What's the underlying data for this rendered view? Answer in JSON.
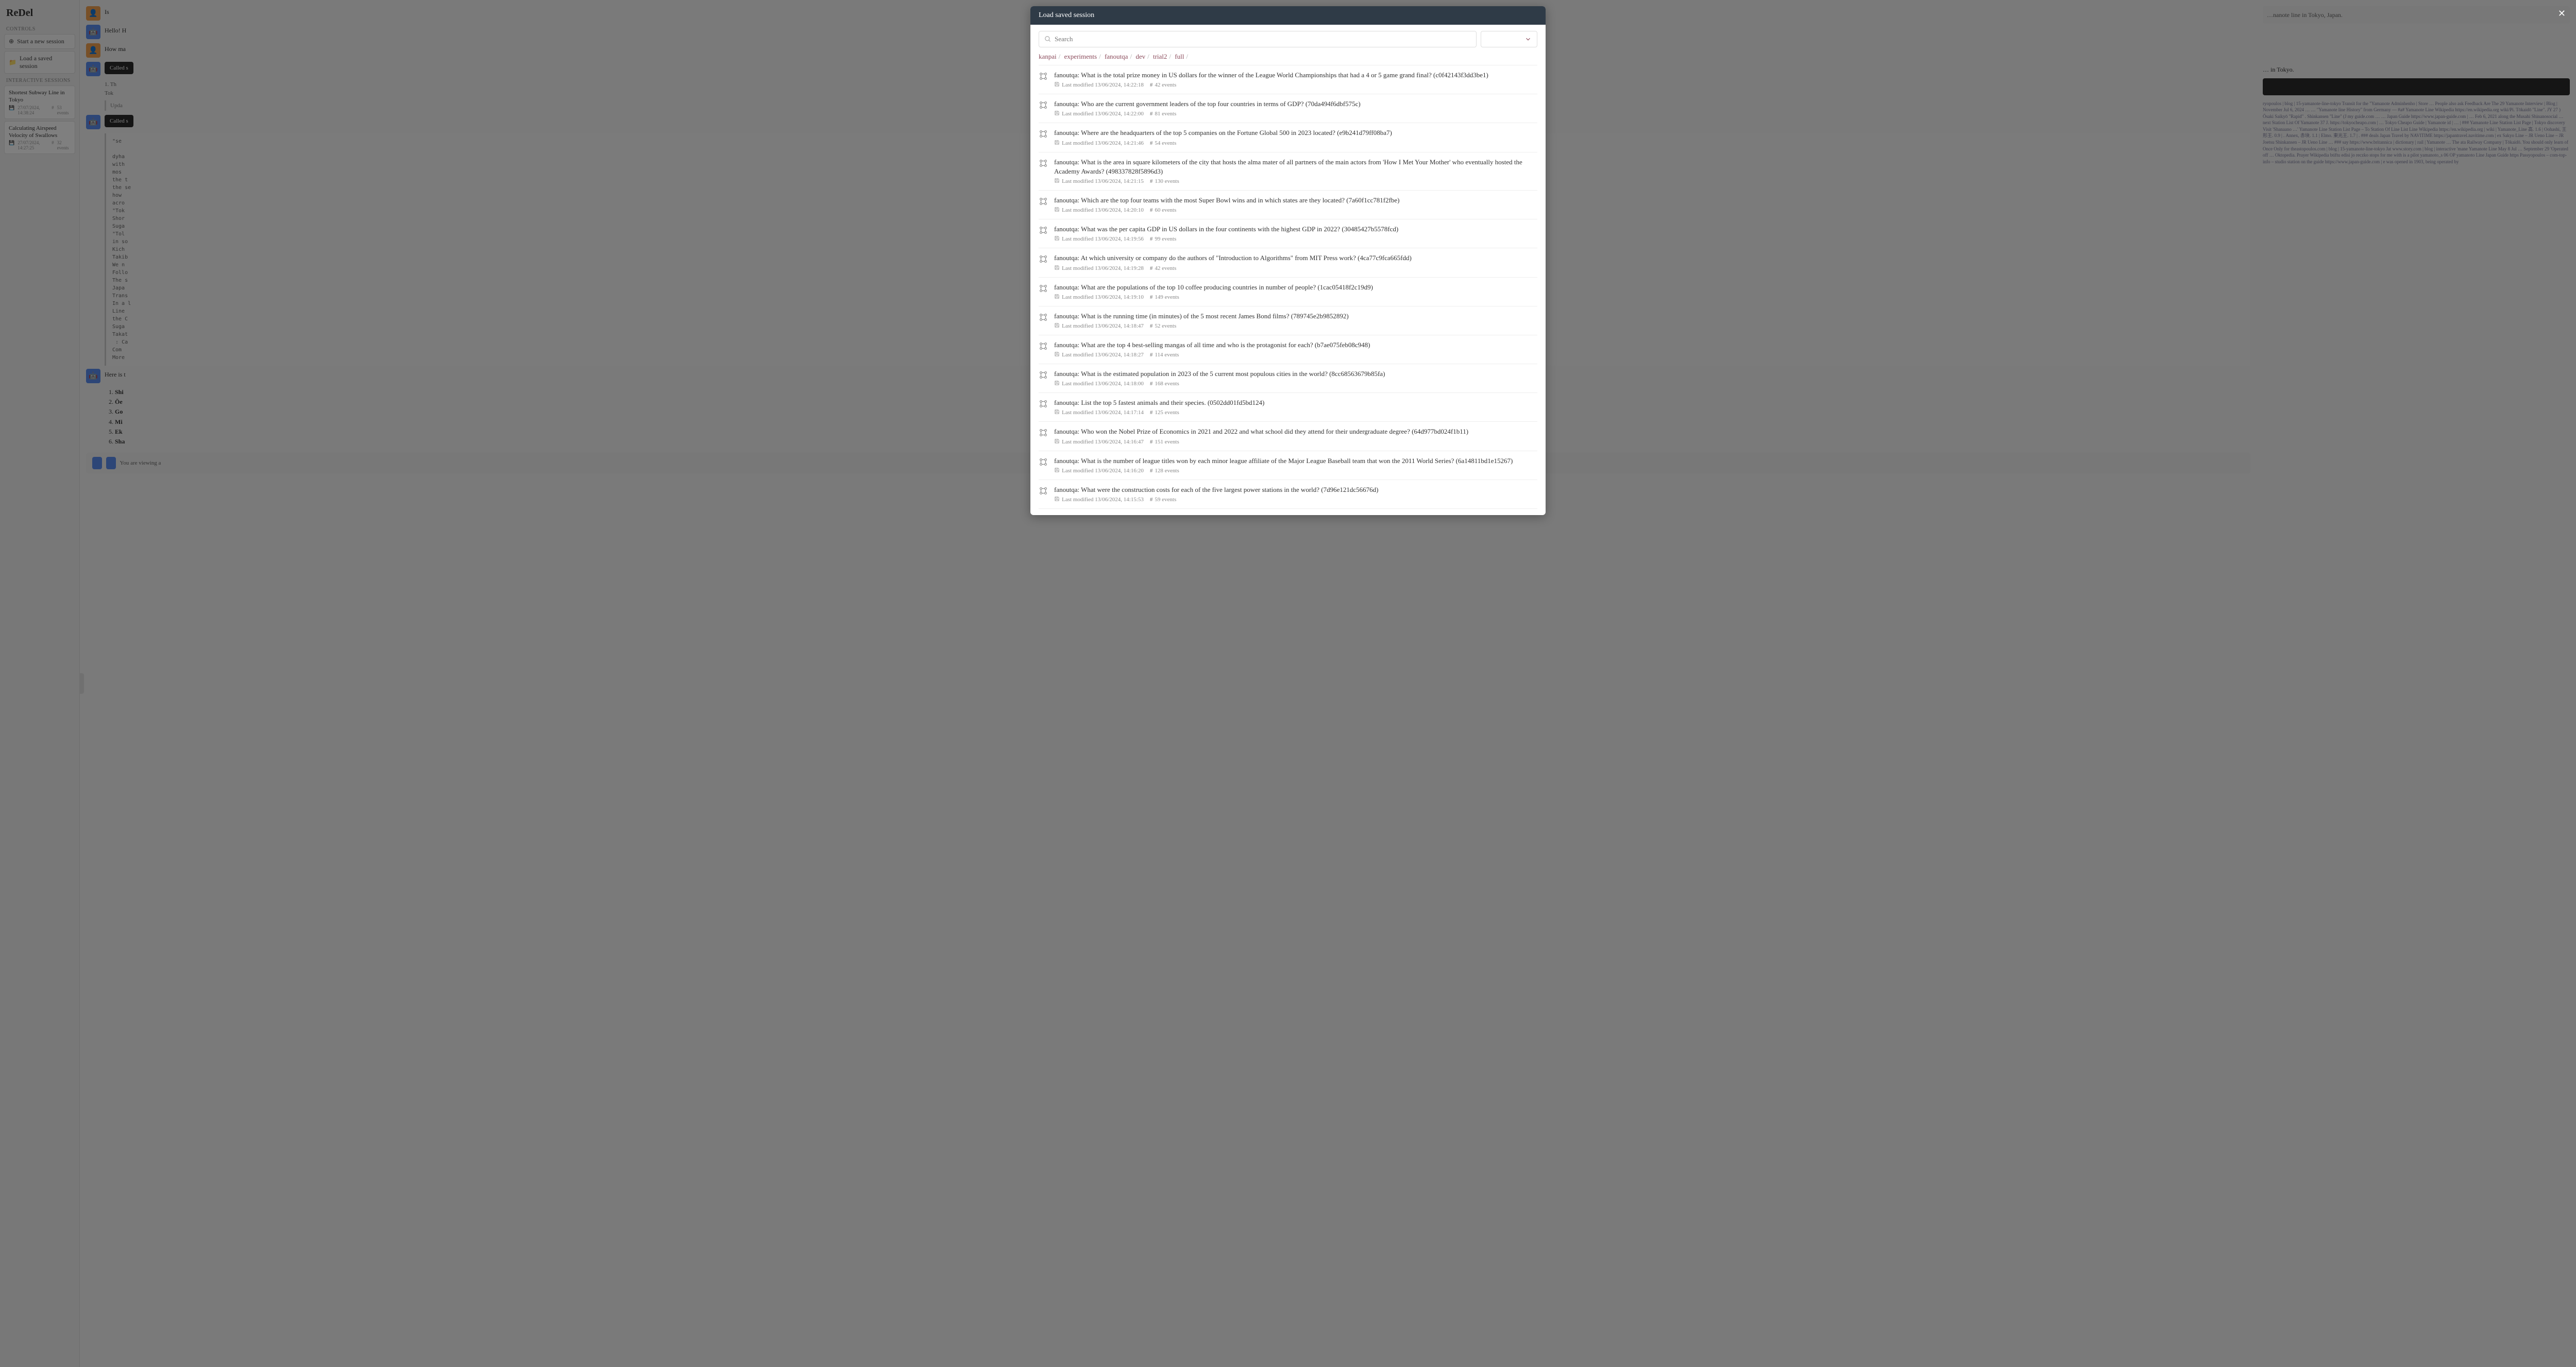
{
  "app": {
    "name": "ReDel"
  },
  "sidebar": {
    "controls_label": "CONTROLS",
    "start_new": "Start a new session",
    "load_saved": "Load a saved session",
    "interactive_label": "INTERACTIVE SESSIONS",
    "sessions": [
      {
        "title": "Shortest Subway Line in Tokyo",
        "date": "27/07/2024, 14:38:24",
        "events": "53 events"
      },
      {
        "title": "Calculating Airspeed Velocity of Swallows",
        "date": "27/07/2024, 14:27:25",
        "events": "32 events"
      }
    ]
  },
  "chat": {
    "msg_user_1": "Is",
    "msg_bot_1": "Hello! H",
    "msg_user_2": "How ma",
    "called_1": "Called s",
    "step_1": "1. Th",
    "step_2": "Tok",
    "updated": "Upda",
    "called_2": "Called s",
    "code_snippet": "\"se\n\ndyha\nwith\nmos\nthe t\nthe se\nhow\nacro\n\"Tok\nShor\nSuga\n\"Tol\nin so\nKich\nTakib\nWe n\nFollo\nThe s\nJapa\nTrans\nIn a l\nLine\nthe C\nSuga\nTakat\n : Ca\nCom\nMore",
    "msg_bot_2": "Here is t",
    "list_items": [
      "Shi",
      "Ōe",
      "Go",
      "Mi",
      "Ek",
      "Sha"
    ],
    "notice": "You are viewing a",
    "right_title": "…nanote line in Tokyo, Japan.",
    "right_sub": "… in Tokyo.",
    "right_blurb": "ryopoulos | blog | 15-yamanote-line-tokyo Transit for the \"Yamanote Adminhenho | Store … People also ask Feedback Are The 29 Yamanote Interview | Blog | November Jul 6, 2024 … … \"Yamanote line History\" from Germany — #a# Yamanote Line Wikipedia https://en.wikipedia.org wiki/Pi. Tōkaidō \"Line\". JY 27 ) Ōsaki Saikyō \"Rapid\" . Shinkansen \"Line\" (J my guide.com … … Japan Guide https://www.japan-guide.com | … Feb 6, 2021 along the Musahi Shinanosocial … next Station List Of Yamanote 37 J. https://tokyocheapo.com | … Tokyo Cheapo Guide | Yamanote id | … | ### Yamanote Line Station List Page | Tokyo discovery Visit 'Shanaano …' Yamanote Line Station List Page – To Station Of Line List Line Wikipedia https://en.wikipedia.org | wiki | Yamanote_Line 高. 1.6 | Oohashi, 王形王. 0.9 | . Annex, 赤块. 1.1 | Elmo. 東光王. 1.7 | . ### deals Japan Travel by NAVITIME https://japantravel.navitime.com | ex Sakyo Line – JR Ueno Line – JR Joetsu Shinkansen – JR Ueno Line … ### say https://www.britannica | dictionary | rail | Yamanote … The ata Railway Company | Tōkaidō. You should only learn of Once Only for theastopoulos.com | blog | 15-yamanote-line-tokyo Jat www.story.com | blog | interactive 'mane Yamanote Line May 8 Jul … September 29 'Operated off … Oktopedia. Prayer Wikipedia btiftu edisi jo reczko\nstops for me with is a pilot yamanoto_s 06 OP yamanoto Line Japan Guide https Passyopoulos – com-top-info – studio station on the guide https://www.japan-guide.com | e was opened in 1903, being operated by"
  },
  "modal": {
    "title": "Load saved session",
    "search_placeholder": "Search",
    "breadcrumb": [
      "kanpai",
      "experiments",
      "fanoutqa",
      "dev",
      "trial2",
      "full"
    ],
    "rows": [
      {
        "title": "fanoutqa: What is the total prize money in US dollars for the winner of the League World Championships that had a 4 or 5 game grand final? (c0f42143f3dd3be1)",
        "modified": "Last modified 13/06/2024, 14:22:18",
        "events": "42 events"
      },
      {
        "title": "fanoutqa: Who are the current government leaders of the top four countries in terms of GDP? (70da494f6dbf575c)",
        "modified": "Last modified 13/06/2024, 14:22:00",
        "events": "81 events"
      },
      {
        "title": "fanoutqa: Where are the headquarters of the top 5 companies on the Fortune Global 500 in 2023 located? (e9b241d79ff08ba7)",
        "modified": "Last modified 13/06/2024, 14:21:46",
        "events": "54 events"
      },
      {
        "title": "fanoutqa: What is the area in square kilometers of the city that hosts the alma mater of all partners of the main actors from 'How I Met Your Mother' who eventually hosted the Academy Awards? (498337828f5896d3)",
        "modified": "Last modified 13/06/2024, 14:21:15",
        "events": "130 events"
      },
      {
        "title": "fanoutqa: Which are the top four teams with the most Super Bowl wins and in which states are they located? (7a60f1cc781f2fbe)",
        "modified": "Last modified 13/06/2024, 14:20:10",
        "events": "60 events"
      },
      {
        "title": "fanoutqa: What was the per capita GDP in US dollars in the four continents with the highest GDP in 2022? (30485427b5578fcd)",
        "modified": "Last modified 13/06/2024, 14:19:56",
        "events": "99 events"
      },
      {
        "title": "fanoutqa: At which university or company do the authors of \"Introduction to Algorithms\" from MIT Press work? (4ca77c9fca665fdd)",
        "modified": "Last modified 13/06/2024, 14:19:28",
        "events": "42 events"
      },
      {
        "title": "fanoutqa: What are the populations of the top 10 coffee producing countries in number of people? (1cac05418f2c19d9)",
        "modified": "Last modified 13/06/2024, 14:19:10",
        "events": "149 events"
      },
      {
        "title": "fanoutqa: What is the running time (in minutes) of the 5 most recent James Bond films? (789745e2b9852892)",
        "modified": "Last modified 13/06/2024, 14:18:47",
        "events": "52 events"
      },
      {
        "title": "fanoutqa: What are the top 4 best-selling mangas of all time and who is the protagonist for each? (b7ae075feb08c948)",
        "modified": "Last modified 13/06/2024, 14:18:27",
        "events": "114 events"
      },
      {
        "title": "fanoutqa: What is the estimated population in 2023 of the 5 current most populous cities in the world? (8cc68563679b85fa)",
        "modified": "Last modified 13/06/2024, 14:18:00",
        "events": "168 events"
      },
      {
        "title": "fanoutqa: List the top 5 fastest animals and their species. (0502dd01fd5bd124)",
        "modified": "Last modified 13/06/2024, 14:17:14",
        "events": "125 events"
      },
      {
        "title": "fanoutqa: Who won the Nobel Prize of Economics in 2021 and 2022 and what school did they attend for their undergraduate degree? (64d977bd024f1b11)",
        "modified": "Last modified 13/06/2024, 14:16:47",
        "events": "151 events"
      },
      {
        "title": "fanoutqa: What is the number of league titles won by each minor league affiliate of the Major League Baseball team that won the 2011 World Series? (6a14811bd1e15267)",
        "modified": "Last modified 13/06/2024, 14:16:20",
        "events": "128 events"
      },
      {
        "title": "fanoutqa: What were the construction costs for each of the five largest power stations in the world? (7d96e121dc56676d)",
        "modified": "Last modified 13/06/2024, 14:15:53",
        "events": "59 events"
      }
    ]
  }
}
